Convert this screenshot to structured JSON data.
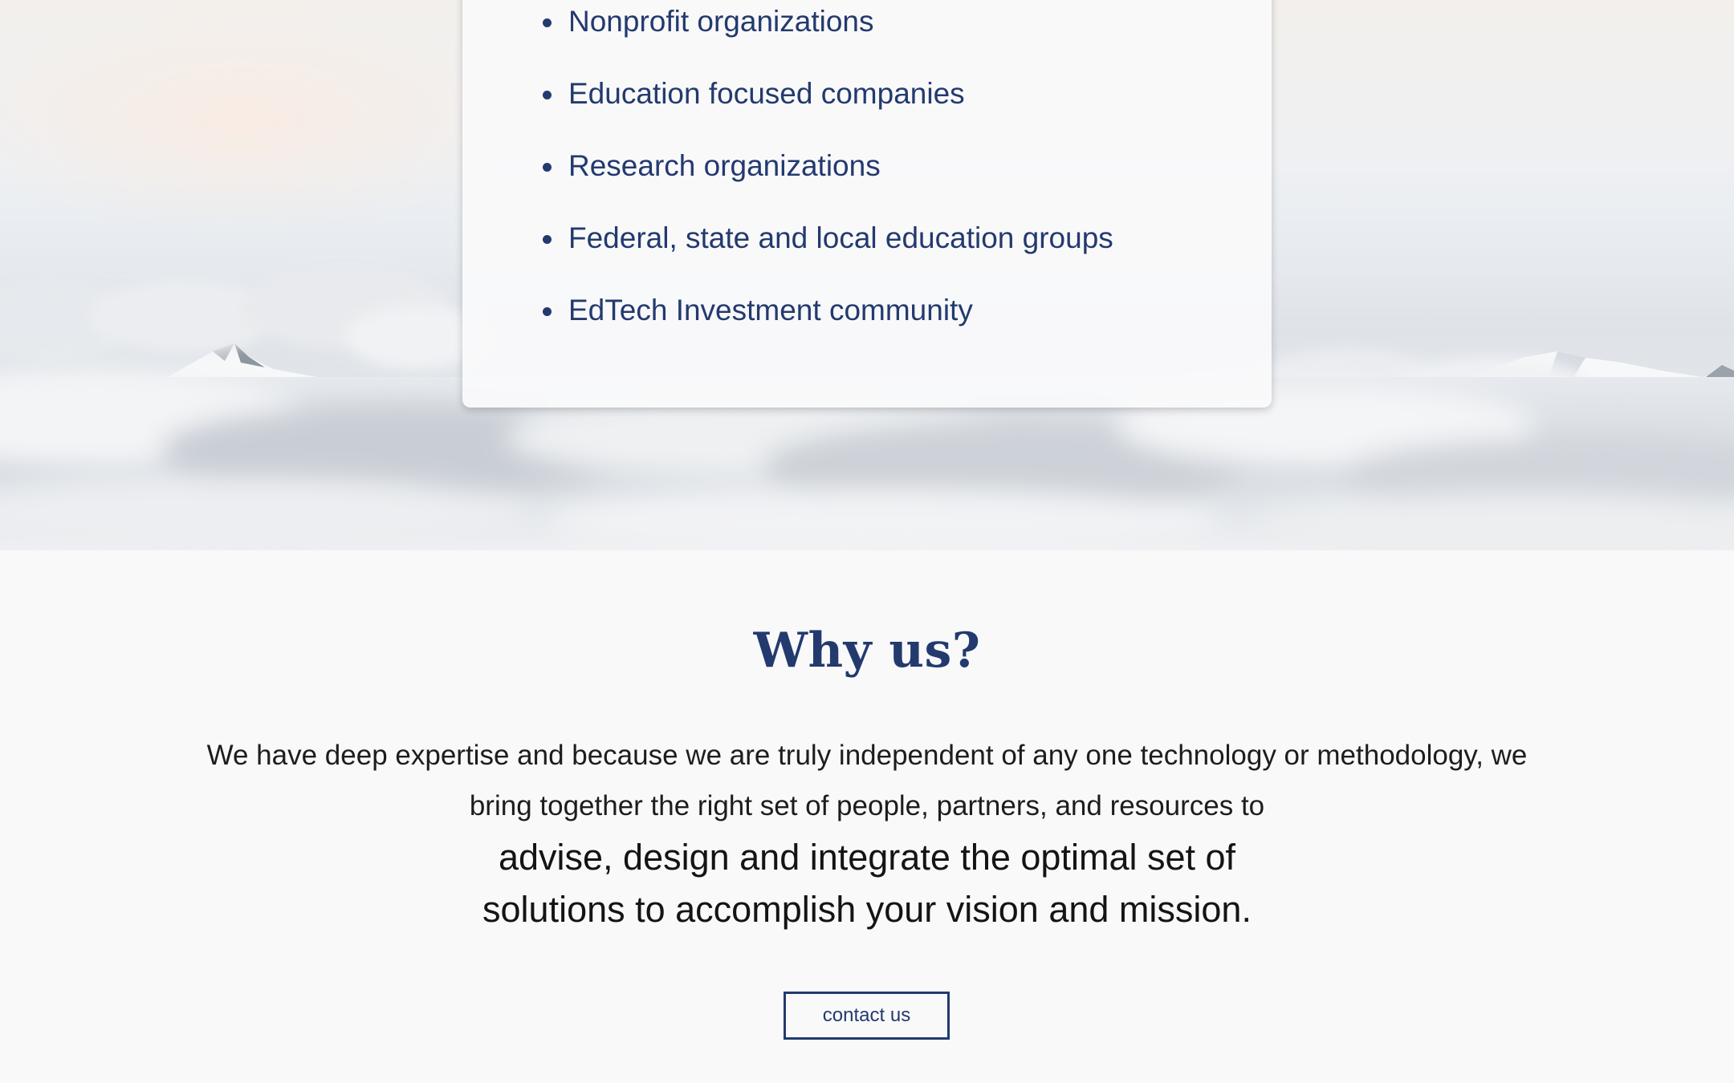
{
  "audience": {
    "items": [
      "Nonprofit organizations",
      "Education focused companies",
      "Research organizations",
      "Federal, state and local education groups",
      "EdTech Investment community"
    ]
  },
  "why": {
    "title": "Why us?",
    "body_line1": "We have deep expertise and because we are truly independent of any one technology or methodology, we",
    "body_line2": "bring together the right set of people, partners, and resources to",
    "emph_line1": "advise, design and integrate the optimal set of",
    "emph_line2": "solutions to accomplish your vision and mission.",
    "cta_label": "contact us"
  },
  "colors": {
    "brand_navy": "#233a6e",
    "body_text": "#1d1d1d",
    "page_bg": "#f9f9fa"
  }
}
